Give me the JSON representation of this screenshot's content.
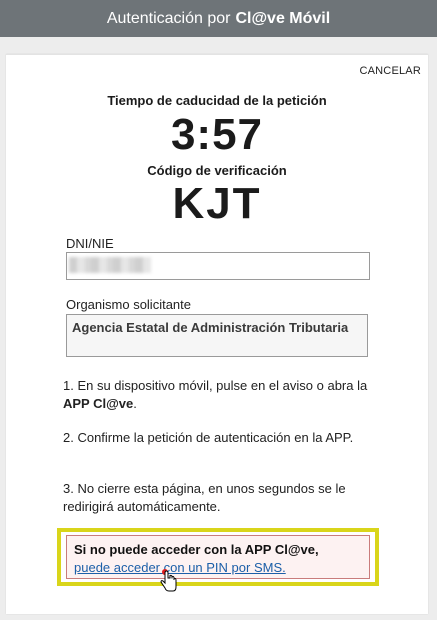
{
  "header": {
    "title_prefix": "Autenticación por",
    "brand": "Cl@ve Móvil"
  },
  "cancel_label": "CANCELAR",
  "expiry": {
    "label": "Tiempo de caducidad de la petición",
    "value": "3:57"
  },
  "verification": {
    "label": "Código de verificación",
    "code": "KJT"
  },
  "dni": {
    "label": "DNI/NIE"
  },
  "org": {
    "label": "Organismo solicitante",
    "value": "Agencia Estatal de Administración Tributaria"
  },
  "steps": {
    "s1_pre": "1. En su dispositivo móvil, pulse en el aviso o abra la ",
    "s1_bold": "APP Cl@ve",
    "s1_post": ".",
    "s2": "2. Confirme la petición de autenticación en la APP.",
    "s3": "3. No cierre esta página, en unos segundos se le redirigirá automáticamente."
  },
  "help": {
    "title": "Si no puede acceder con la APP Cl@ve,",
    "link": "puede acceder con un PIN por SMS."
  },
  "colors": {
    "header_bg": "#6e7478",
    "highlight": "#d9d51a",
    "link": "#1c5fa8"
  },
  "icons": {
    "cursor": "hand-pointer-icon"
  }
}
